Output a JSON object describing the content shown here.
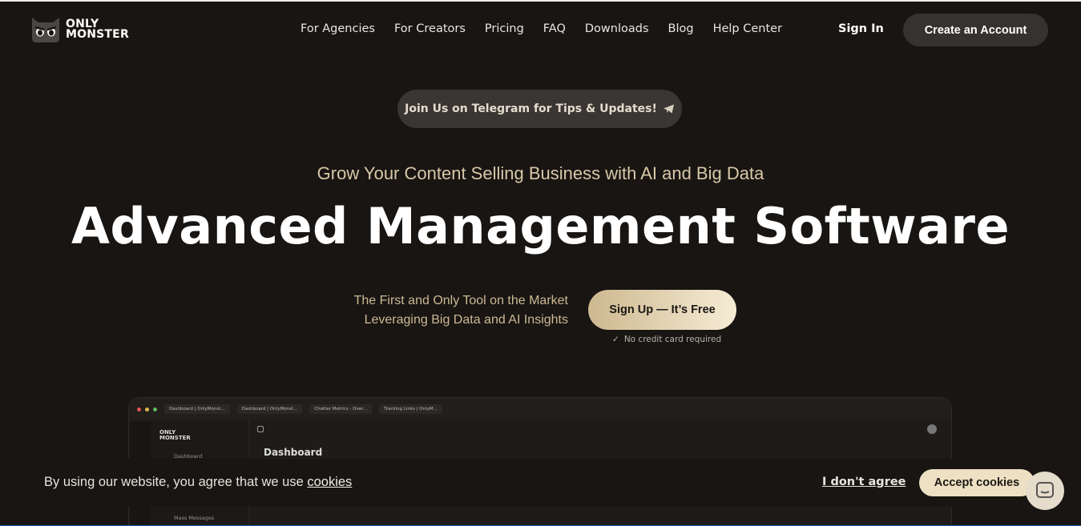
{
  "brand": {
    "line1": "ONLY",
    "line2": "MONSTER"
  },
  "nav": [
    {
      "label": "For Agencies"
    },
    {
      "label": "For Creators"
    },
    {
      "label": "Pricing"
    },
    {
      "label": "FAQ"
    },
    {
      "label": "Downloads"
    },
    {
      "label": "Blog"
    },
    {
      "label": "Help Center"
    }
  ],
  "header": {
    "signin": "Sign In",
    "create": "Create an Account"
  },
  "telegram": {
    "label": "Join Us on Telegram for Tips & Updates!",
    "icon": "telegram-plane-icon"
  },
  "hero": {
    "subtitle": "Grow Your Content Selling Business with AI and Big Data",
    "headline": "Advanced Management Software",
    "tagline1": "The First and Only Tool on the Market",
    "tagline2": "Leveraging Big Data and AI Insights",
    "cta": "Sign Up — It’s Free",
    "cta_note": "No credit card required"
  },
  "preview": {
    "tabs": [
      "Dashboard | OnlyMonst...",
      "Dashboard | OnlyMonst...",
      "Chatter Metrics - Over...",
      "Tracking Links | OnlyM..."
    ],
    "brand1": "ONLY",
    "brand2": "MONSTER",
    "sidebar_item1": "Dashboard",
    "sidebar_item2": "Mass Messages",
    "title": "Dashboard"
  },
  "cookie": {
    "text": "By using our website, you agree that we use ",
    "link": "cookies",
    "disagree": "I don't agree",
    "accept": "Accept cookies"
  },
  "colors": {
    "background": "#181512",
    "accent": "#eee1c3",
    "button_dark": "#353230"
  }
}
